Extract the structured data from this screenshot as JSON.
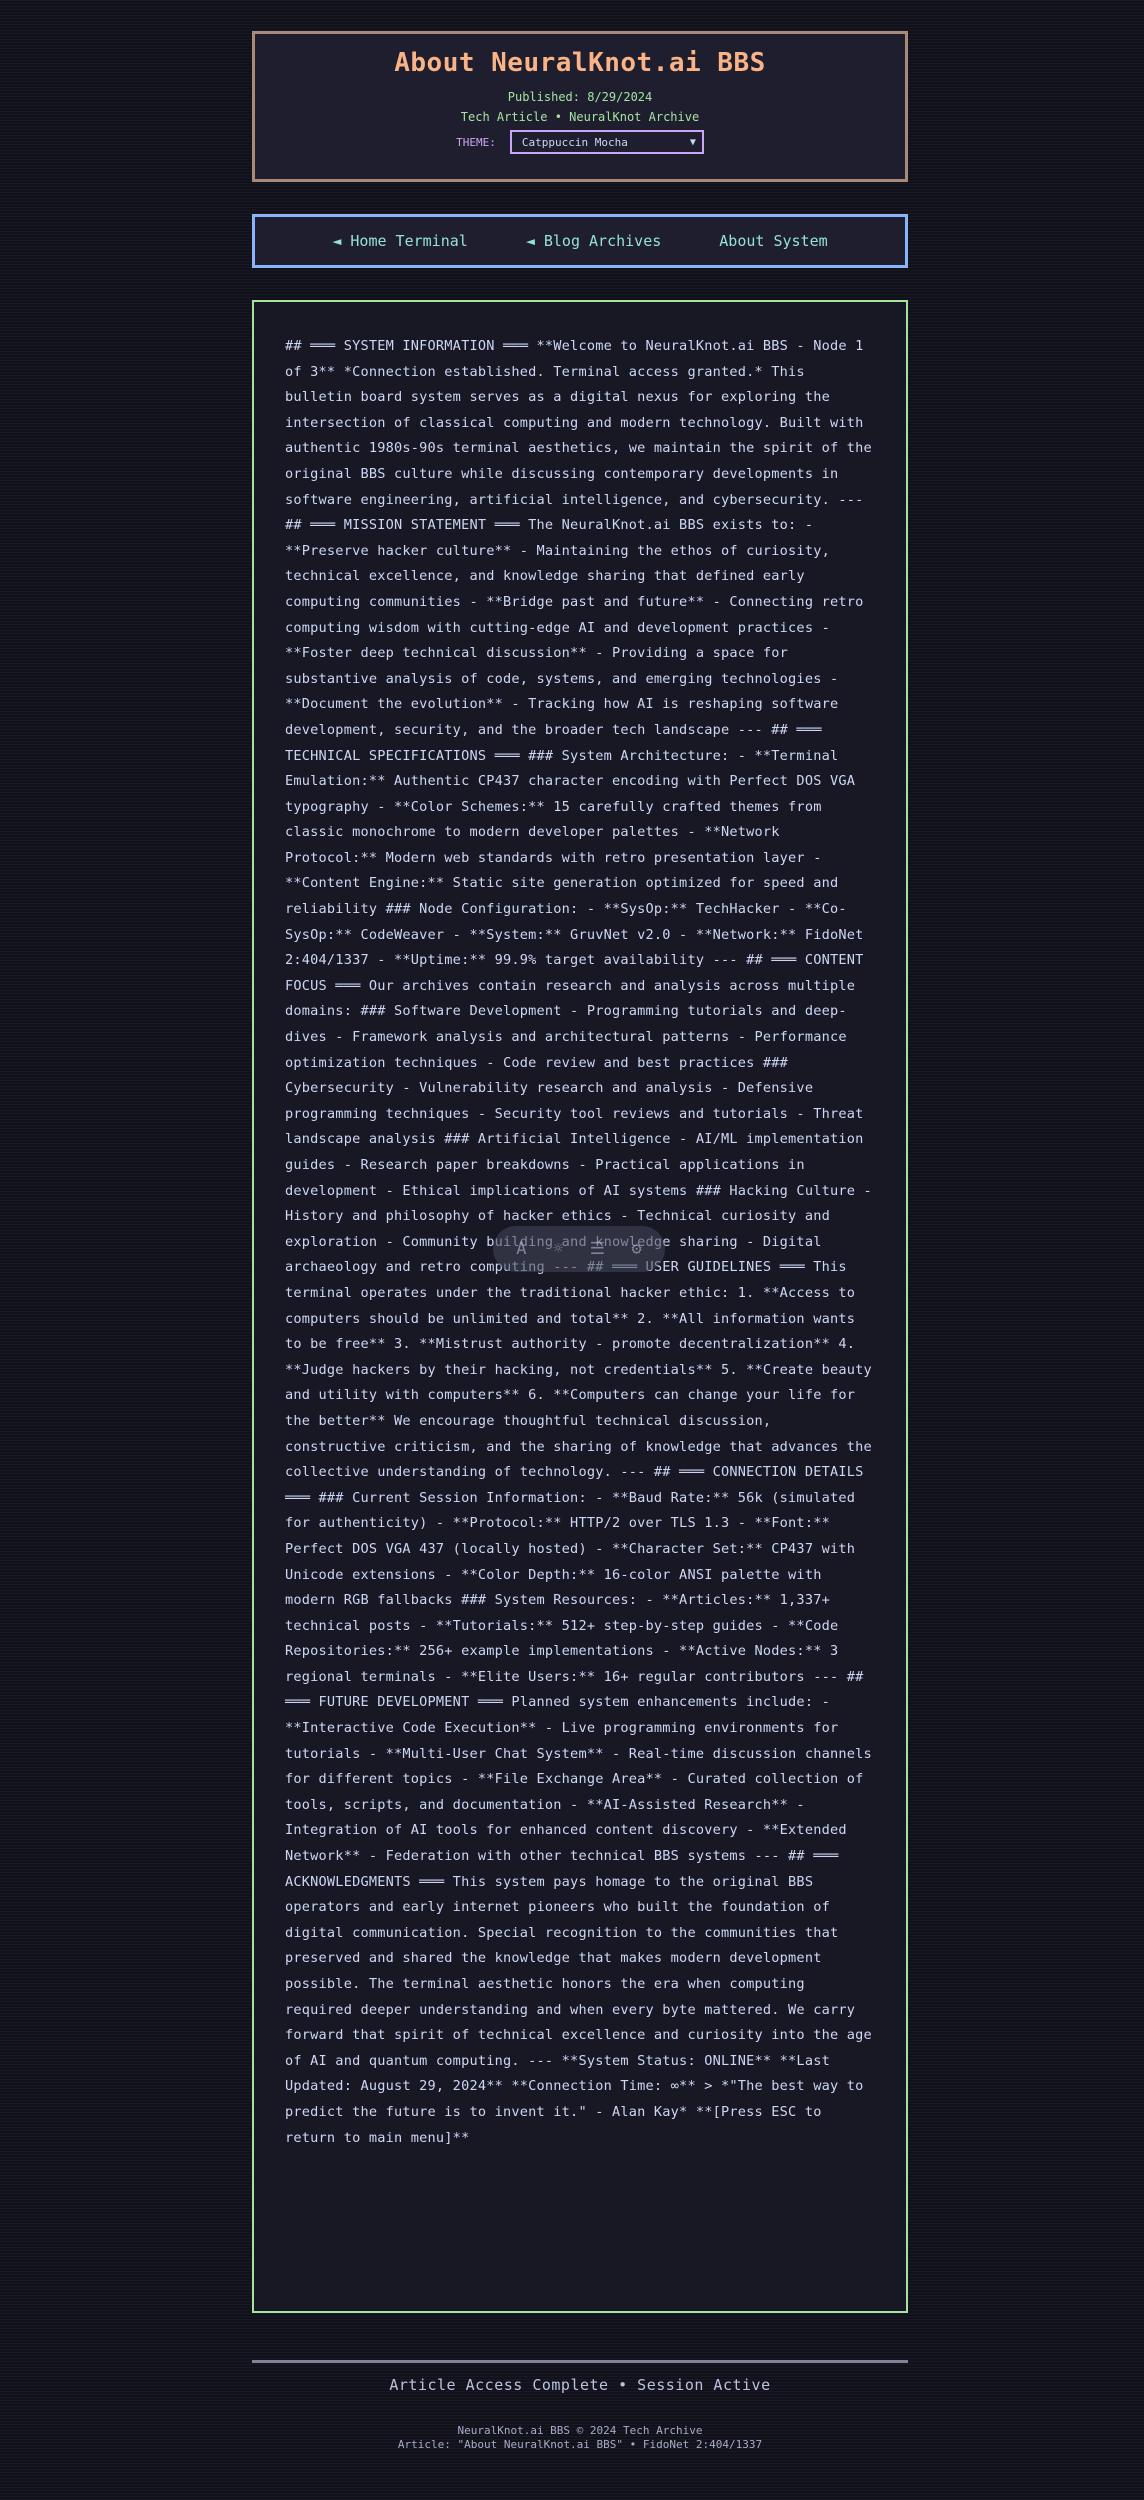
{
  "header": {
    "title": "About NeuralKnot.ai BBS",
    "published": "Published: 8/29/2024",
    "byline": "Tech Article • NeuralKnot Archive",
    "theme_label": "THEME:",
    "theme_value": "Catppuccin Mocha"
  },
  "nav": {
    "home": "◄ Home Terminal",
    "archives": "◄ Blog Archives",
    "about": "About System"
  },
  "article": {
    "body": "## ═══ SYSTEM INFORMATION ═══ **Welcome to NeuralKnot.ai BBS - Node 1 of 3** *Connection established. Terminal access granted.* This bulletin board system serves as a digital nexus for exploring the intersection of classical computing and modern technology. Built with authentic 1980s-90s terminal aesthetics, we maintain the spirit of the original BBS culture while discussing contemporary developments in software engineering, artificial intelligence, and cybersecurity. --- ## ═══ MISSION STATEMENT ═══ The NeuralKnot.ai BBS exists to: - **Preserve hacker culture** - Maintaining the ethos of curiosity, technical excellence, and knowledge sharing that defined early computing communities - **Bridge past and future** - Connecting retro computing wisdom with cutting-edge AI and development practices - **Foster deep technical discussion** - Providing a space for substantive analysis of code, systems, and emerging technologies - **Document the evolution** - Tracking how AI is reshaping software development, security, and the broader tech landscape --- ## ═══ TECHNICAL SPECIFICATIONS ═══ ### System Architecture: - **Terminal Emulation:** Authentic CP437 character encoding with Perfect DOS VGA typography - **Color Schemes:** 15 carefully crafted themes from classic monochrome to modern developer palettes - **Network Protocol:** Modern web standards with retro presentation layer - **Content Engine:** Static site generation optimized for speed and reliability ### Node Configuration: - **SysOp:** TechHacker - **Co-SysOp:** CodeWeaver - **System:** GruvNet v2.0 - **Network:** FidoNet 2:404/1337 - **Uptime:** 99.9% target availability --- ## ═══ CONTENT FOCUS ═══ Our archives contain research and analysis across multiple domains: ### Software Development - Programming tutorials and deep-dives - Framework analysis and architectural patterns - Performance optimization techniques - Code review and best practices ### Cybersecurity - Vulnerability research and analysis - Defensive programming techniques - Security tool reviews and tutorials - Threat landscape analysis ### Artificial Intelligence - AI/ML implementation guides - Research paper breakdowns - Practical applications in development - Ethical implications of AI systems ### Hacking Culture - History and philosophy of hacker ethics - Technical curiosity and exploration - Community building and knowledge sharing - Digital archaeology and retro computing --- ## ═══ USER GUIDELINES ═══ This terminal operates under the traditional hacker ethic: 1. **Access to computers should be unlimited and total** 2. **All information wants to be free** 3. **Mistrust authority - promote decentralization** 4. **Judge hackers by their hacking, not credentials** 5. **Create beauty and utility with computers** 6. **Computers can change your life for the better** We encourage thoughtful technical discussion, constructive criticism, and the sharing of knowledge that advances the collective understanding of technology. --- ## ═══ CONNECTION DETAILS ═══ ### Current Session Information: - **Baud Rate:** 56k (simulated for authenticity) - **Protocol:** HTTP/2 over TLS 1.3 - **Font:** Perfect DOS VGA 437 (locally hosted) - **Character Set:** CP437 with Unicode extensions - **Color Depth:** 16-color ANSI palette with modern RGB fallbacks ### System Resources: - **Articles:** 1,337+ technical posts - **Tutorials:** 512+ step-by-step guides - **Code Repositories:** 256+ example implementations - **Active Nodes:** 3 regional terminals - **Elite Users:** 16+ regular contributors --- ## ═══ FUTURE DEVELOPMENT ═══ Planned system enhancements include: - **Interactive Code Execution** - Live programming environments for tutorials - **Multi-User Chat System** - Real-time discussion channels for different topics - **File Exchange Area** - Curated collection of tools, scripts, and documentation - **AI-Assisted Research** - Integration of AI tools for enhanced content discovery - **Extended Network** - Federation with other technical BBS systems --- ## ═══ ACKNOWLEDGMENTS ═══ This system pays homage to the original BBS operators and early internet pioneers who built the foundation of digital communication. Special recognition to the communities that preserved and shared the knowledge that makes modern development possible. The terminal aesthetic honors the era when computing required deeper understanding and when every byte mattered. We carry forward that spirit of technical excellence and curiosity into the age of AI and quantum computing. --- **System Status: ONLINE** **Last Updated: August 29, 2024** **Connection Time: ∞** > *\"The best way to predict the future is to invent it.\" - Alan Kay* **[Press ESC to return to main menu]**"
  },
  "toolbar": {
    "icons": [
      "font-icon",
      "brightness-icon",
      "reader-list-icon",
      "settings-icon"
    ]
  },
  "footer": {
    "status": "Article Access Complete • Session Active",
    "copyright": "NeuralKnot.ai BBS © 2024 Tech Archive",
    "article_ref": "Article: \"About NeuralKnot.ai BBS\" • FidoNet 2:404/1337"
  },
  "colors": {
    "background": "#11111b",
    "title": "#fab387",
    "accent_green": "#a6e3a1",
    "accent_blue": "#89b4fa",
    "accent_purple": "#cba6f7",
    "link": "#94e2d5"
  }
}
